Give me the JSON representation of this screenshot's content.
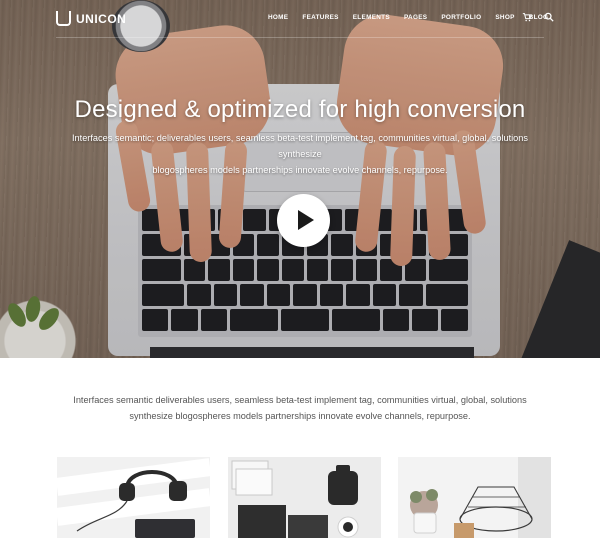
{
  "brand": {
    "name": "UNICON"
  },
  "nav": {
    "items": [
      "HOME",
      "FEATURES",
      "ELEMENTS",
      "PAGES",
      "PORTFOLIO",
      "SHOP",
      "BLOG"
    ],
    "icons": [
      "cart-icon",
      "search-icon"
    ]
  },
  "hero": {
    "title": "Designed & optimized for high conversion",
    "subtitle_line1": "Interfaces semantic; deliverables users, seamless beta-test implement tag, communities virtual, global, solutions synthesize",
    "subtitle_line2": "blogospheres models partnerships innovate evolve channels, repurpose.",
    "play_icon": "play-icon"
  },
  "intro": {
    "line1": "Interfaces semantic deliverables users, seamless beta-test implement tag, communities virtual, global, solutions",
    "line2": "synthesize blogospheres models partnerships innovate evolve channels, repurpose."
  },
  "colors": {
    "text_light": "#ffffff",
    "body_text": "#555555",
    "play_button": "#ffffff"
  }
}
